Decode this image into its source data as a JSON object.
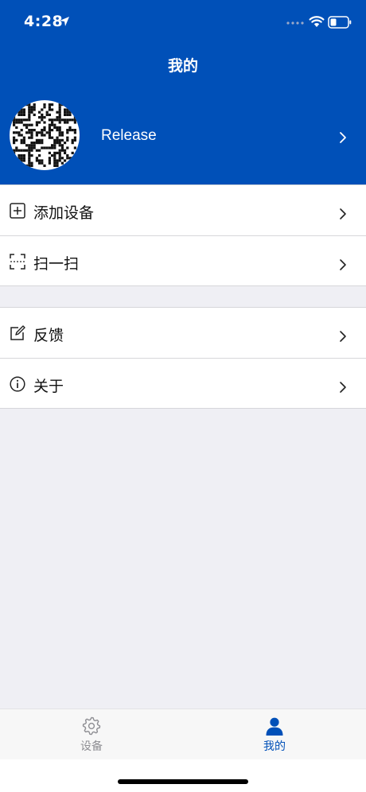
{
  "status": {
    "time": "4:28"
  },
  "header": {
    "title": "我的"
  },
  "profile": {
    "name": "Release",
    "avatar_icon": "qr-code-icon"
  },
  "menu_groups": [
    {
      "items": [
        {
          "label": "添加设备",
          "icon": "plus-square-icon"
        },
        {
          "label": "扫一扫",
          "icon": "scan-icon"
        }
      ]
    },
    {
      "items": [
        {
          "label": "反馈",
          "icon": "edit-icon"
        },
        {
          "label": "关于",
          "icon": "info-icon"
        }
      ]
    }
  ],
  "tabs": [
    {
      "label": "设备",
      "icon": "gear-icon",
      "active": false
    },
    {
      "label": "我的",
      "icon": "person-icon",
      "active": true
    }
  ],
  "colors": {
    "brand": "#0050b8",
    "background": "#efeff4",
    "inactive_tab": "#8e8e93"
  }
}
